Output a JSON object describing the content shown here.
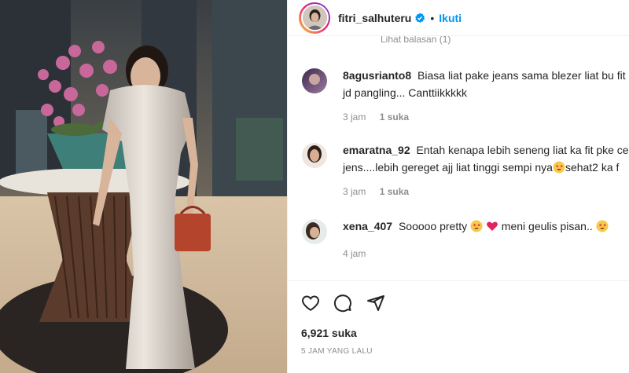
{
  "header": {
    "username": "fitri_salhuteru",
    "separator": "•",
    "follow_label": "Ikuti"
  },
  "replies_link": "Lihat balasan (1)",
  "comments": [
    {
      "user": "8agusrianto8",
      "text_1": "Biasa liat pake jeans sama blezer liat bu fit",
      "text_2": "jd pangling... Canttiikkkkk",
      "time": "3 jam",
      "likes": "1 suka"
    },
    {
      "user": "emaratna_92",
      "text_1": "Entah kenapa lebih seneng liat ka fit pke ce",
      "text_2a": "jens....lebih gereget ajj liat tinggi sempi nya",
      "text_2b": "sehat2 ka f",
      "time": "3 jam",
      "likes": "1 suka"
    },
    {
      "user": "xena_407",
      "text_1": "Sooooo pretty",
      "text_2": "meni geulis pisan..",
      "time": "4 jam"
    }
  ],
  "likes_count": "6,921 suka",
  "time_ago": "5 JAM YANG LALU",
  "icons": {
    "like": "heart-outline-icon",
    "comment": "comment-bubble-icon",
    "share": "paper-plane-icon",
    "verified": "verified-badge-icon"
  },
  "colors": {
    "accent": "#0095f6",
    "text": "#262626",
    "muted": "#8e8e8e",
    "heart": "#ed4956"
  }
}
